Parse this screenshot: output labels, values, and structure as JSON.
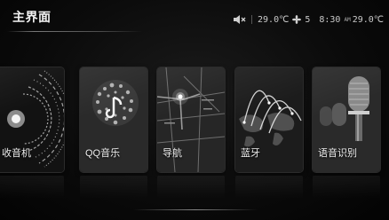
{
  "header": {
    "title": "主界面"
  },
  "status": {
    "temp_left": "29.0℃",
    "fan_level": "5",
    "time": "8:30",
    "ampm": "AM",
    "temp_right": "29.0℃"
  },
  "cards": [
    {
      "label": "收音机",
      "icon": "radio-icon"
    },
    {
      "label": "QQ音乐",
      "icon": "qq-music-icon"
    },
    {
      "label": "导航",
      "icon": "map-icon"
    },
    {
      "label": "蓝牙",
      "icon": "bluetooth-icon"
    },
    {
      "label": "语音识别",
      "icon": "microphone-icon"
    }
  ]
}
